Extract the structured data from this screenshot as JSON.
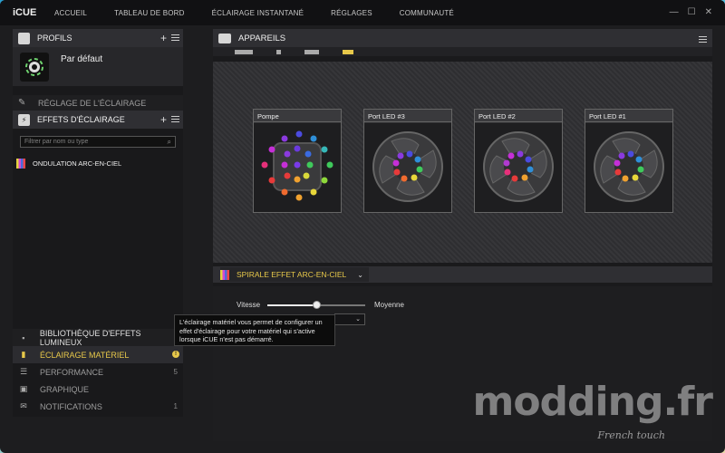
{
  "app": {
    "title": "iCUE"
  },
  "nav": [
    "ACCUEIL",
    "TABLEAU DE BORD",
    "ÉCLAIRAGE INSTANTANÉ",
    "RÉGLAGES",
    "COMMUNAUTÉ"
  ],
  "window": {
    "minimize": "—",
    "maximize": "☐",
    "close": "✕"
  },
  "profiles": {
    "header": "PROFILS",
    "active_profile": "Par défaut"
  },
  "lighting_setup": "RÉGLAGE DE L'ÉCLAIRAGE",
  "effects": {
    "header": "EFFETS D'ÉCLAIRAGE",
    "search_placeholder": "Filtrer par nom ou type",
    "items": [
      "ONDULATION ARC-EN-CIEL"
    ]
  },
  "bottom_nav": {
    "library": "BIBLIOTHÈQUE D'EFFETS LUMINEUX",
    "hardware": "ÉCLAIRAGE MATÉRIEL",
    "performance": "PERFORMANCE",
    "performance_count": "5",
    "graph": "GRAPHIQUE",
    "notifications": "NOTIFICATIONS",
    "notifications_count": "1"
  },
  "tooltip": "L'éclairage matériel vous permet de configurer un effet d'éclairage pour votre matériel qui s'active lorsque iCUE n'est pas démarré.",
  "devices": {
    "header": "APPAREILS",
    "cards": [
      "Pompe",
      "Port LED #3",
      "Port LED #2",
      "Port LED #1"
    ]
  },
  "effect_panel": {
    "selected": "SPIRALE EFFET ARC-EN-CIEL",
    "speed_label": "Vitesse",
    "speed_value": "Moyenne",
    "speed_level": 0.5
  },
  "watermark": {
    "main": "modding.fr",
    "sub": "French touch"
  }
}
